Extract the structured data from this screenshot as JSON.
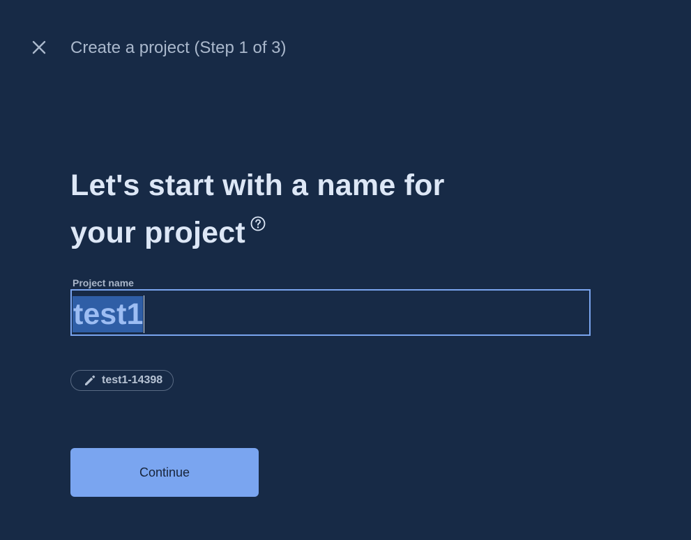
{
  "header": {
    "title": "Create a project (Step 1 of 3)",
    "close_icon": "close-icon"
  },
  "main": {
    "heading_line1": "Let's start with a name for",
    "heading_line2": "your project",
    "help_icon": "help-circle-icon",
    "field_label": "Project name",
    "project_name_value": "test1",
    "project_id_chip": "test1-14398",
    "edit_icon": "pencil-icon",
    "continue_label": "Continue"
  },
  "colors": {
    "background": "#172a46",
    "accent": "#7aa5f0",
    "focus_border": "#7aa5ef",
    "selection": "#2f5ea6"
  }
}
